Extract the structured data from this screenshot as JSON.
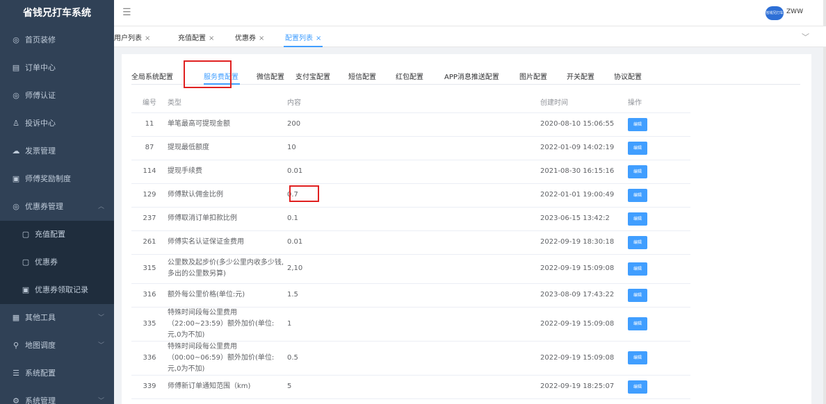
{
  "sidebar": {
    "logo": "省钱兄打车系统",
    "items": [
      {
        "icon": "cube-icon",
        "glyph": "◎",
        "label": "首页装修"
      },
      {
        "icon": "list-icon",
        "glyph": "▤",
        "label": "订单中心"
      },
      {
        "icon": "cube-icon",
        "glyph": "◎",
        "label": "师傅认证"
      },
      {
        "icon": "user-icon",
        "glyph": "♙",
        "label": "投诉中心"
      },
      {
        "icon": "cloud-icon",
        "glyph": "☁",
        "label": "发票管理"
      },
      {
        "icon": "card-icon",
        "glyph": "▣",
        "label": "师傅奖励制度"
      },
      {
        "icon": "cube-icon",
        "glyph": "◎",
        "label": "优惠券管理"
      }
    ],
    "submenu": [
      {
        "icon": "card-icon",
        "glyph": "▢",
        "label": "充值配置"
      },
      {
        "icon": "card-icon",
        "glyph": "▢",
        "label": "优惠券"
      },
      {
        "icon": "card-icon",
        "glyph": "▣",
        "label": "优惠券领取记录"
      }
    ],
    "items_after": [
      {
        "icon": "calendar-icon",
        "glyph": "▦",
        "label": "其他工具"
      },
      {
        "icon": "location-icon",
        "glyph": "⚲",
        "label": "地图调度"
      },
      {
        "icon": "list-icon",
        "glyph": "☰",
        "label": "系统配置"
      },
      {
        "icon": "gear-icon",
        "glyph": "⚙",
        "label": "系统管理"
      }
    ]
  },
  "topbar": {
    "avatar_text": "省钱兄打车",
    "username": "ZWW"
  },
  "tags": [
    {
      "label": "用户列表"
    },
    {
      "label": "充值配置"
    },
    {
      "label": "优惠券"
    },
    {
      "label": "配置列表"
    }
  ],
  "subtabs": [
    "全局系统配置",
    "服务费配置",
    "微信配置",
    "支付宝配置",
    "短信配置",
    "红包配置",
    "APP消息推送配置",
    "图片配置",
    "开关配置",
    "协议配置"
  ],
  "table": {
    "headers": {
      "id": "编号",
      "type": "类型",
      "content": "内容",
      "created": "创建时间",
      "action": "操作"
    },
    "edit_label": "编辑",
    "rows": [
      {
        "id": "11",
        "type": "单笔最高可提现金额",
        "content": "200",
        "created": "2020-08-10 15:06:55"
      },
      {
        "id": "87",
        "type": "提现最低额度",
        "content": "10",
        "created": "2022-01-09 14:02:19"
      },
      {
        "id": "114",
        "type": "提现手续费",
        "content": "0.01",
        "created": "2021-08-30 16:15:16"
      },
      {
        "id": "129",
        "type": "师傅默认佣金比例",
        "content": "0.7",
        "created": "2022-01-01 19:00:49"
      },
      {
        "id": "237",
        "type": "师傅取消订单扣款比例",
        "content": "0.1",
        "created": "2023-06-15 13:42:2"
      },
      {
        "id": "261",
        "type": "师傅实名认证保证金费用",
        "content": "0.01",
        "created": "2022-09-19 18:30:18"
      },
      {
        "id": "315",
        "type": "公里数及起步价(多少公里内收多少钱,多出的公里数另算)",
        "content": "2,10",
        "created": "2022-09-19 15:09:08"
      },
      {
        "id": "316",
        "type": "额外每公里价格(单位:元)",
        "content": "1.5",
        "created": "2023-08-09 17:43:22"
      },
      {
        "id": "335",
        "type": "特殊时间段每公里费用（22:00~23:59）额外加价(单位:元,0为不加)",
        "content": "1",
        "created": "2022-09-19 15:09:08"
      },
      {
        "id": "336",
        "type": "特殊时间段每公里费用（00:00~06:59）额外加价(单位:元,0为不加)",
        "content": "0.5",
        "created": "2022-09-19 15:09:08"
      },
      {
        "id": "339",
        "type": "师傅新订单通知范围（km)",
        "content": "5",
        "created": "2022-09-19 18:25:07"
      }
    ]
  },
  "colors": {
    "sidebar": "#304156",
    "submenu": "#1f2d3d",
    "accent": "#409eff",
    "highlight": "#e02020"
  }
}
